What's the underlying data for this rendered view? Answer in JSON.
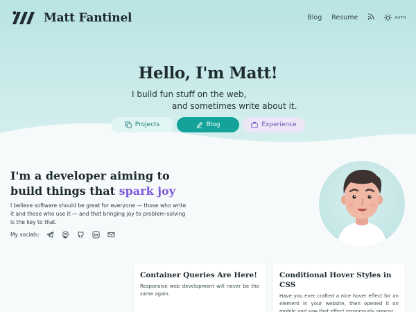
{
  "header": {
    "logo_text": "Matt Fantinel",
    "nav": {
      "blog": "Blog",
      "resume": "Resume",
      "theme_label": "AUTO"
    }
  },
  "hero": {
    "title": "Hello, I'm Matt!",
    "tagline_line1": "I build fun stuff on the web,",
    "tagline_line2": "and sometimes write about it.",
    "buttons": {
      "projects": "Projects",
      "blog": "Blog",
      "experience": "Experience"
    }
  },
  "intro": {
    "heading_part1": "I'm a developer aiming to build things that ",
    "heading_highlight": "spark joy",
    "body": "I believe software should be great for everyone — those who write it and those who use it — and that bringing joy to problem-solving is the key to that.",
    "socials_label": "My socials:"
  },
  "posts": [
    {
      "title": "Container Queries Are Here!",
      "excerpt": "Responsive web development will never be the same again."
    },
    {
      "title": "Conditional Hover Styles in CSS",
      "excerpt": "Have you ever crafted a nice hover effect for an element in your website, then opened it on mobile and saw that effect erroneously appear"
    }
  ],
  "colors": {
    "accent": "#13a39a",
    "highlight": "#7a5ad8",
    "hero_bg": "#c9eaea"
  },
  "icons": {
    "rss": "rss-icon",
    "theme": "sun-icon",
    "socials": [
      "telegram-icon",
      "mastodon-icon",
      "github-icon",
      "linkedin-icon",
      "email-icon"
    ]
  }
}
